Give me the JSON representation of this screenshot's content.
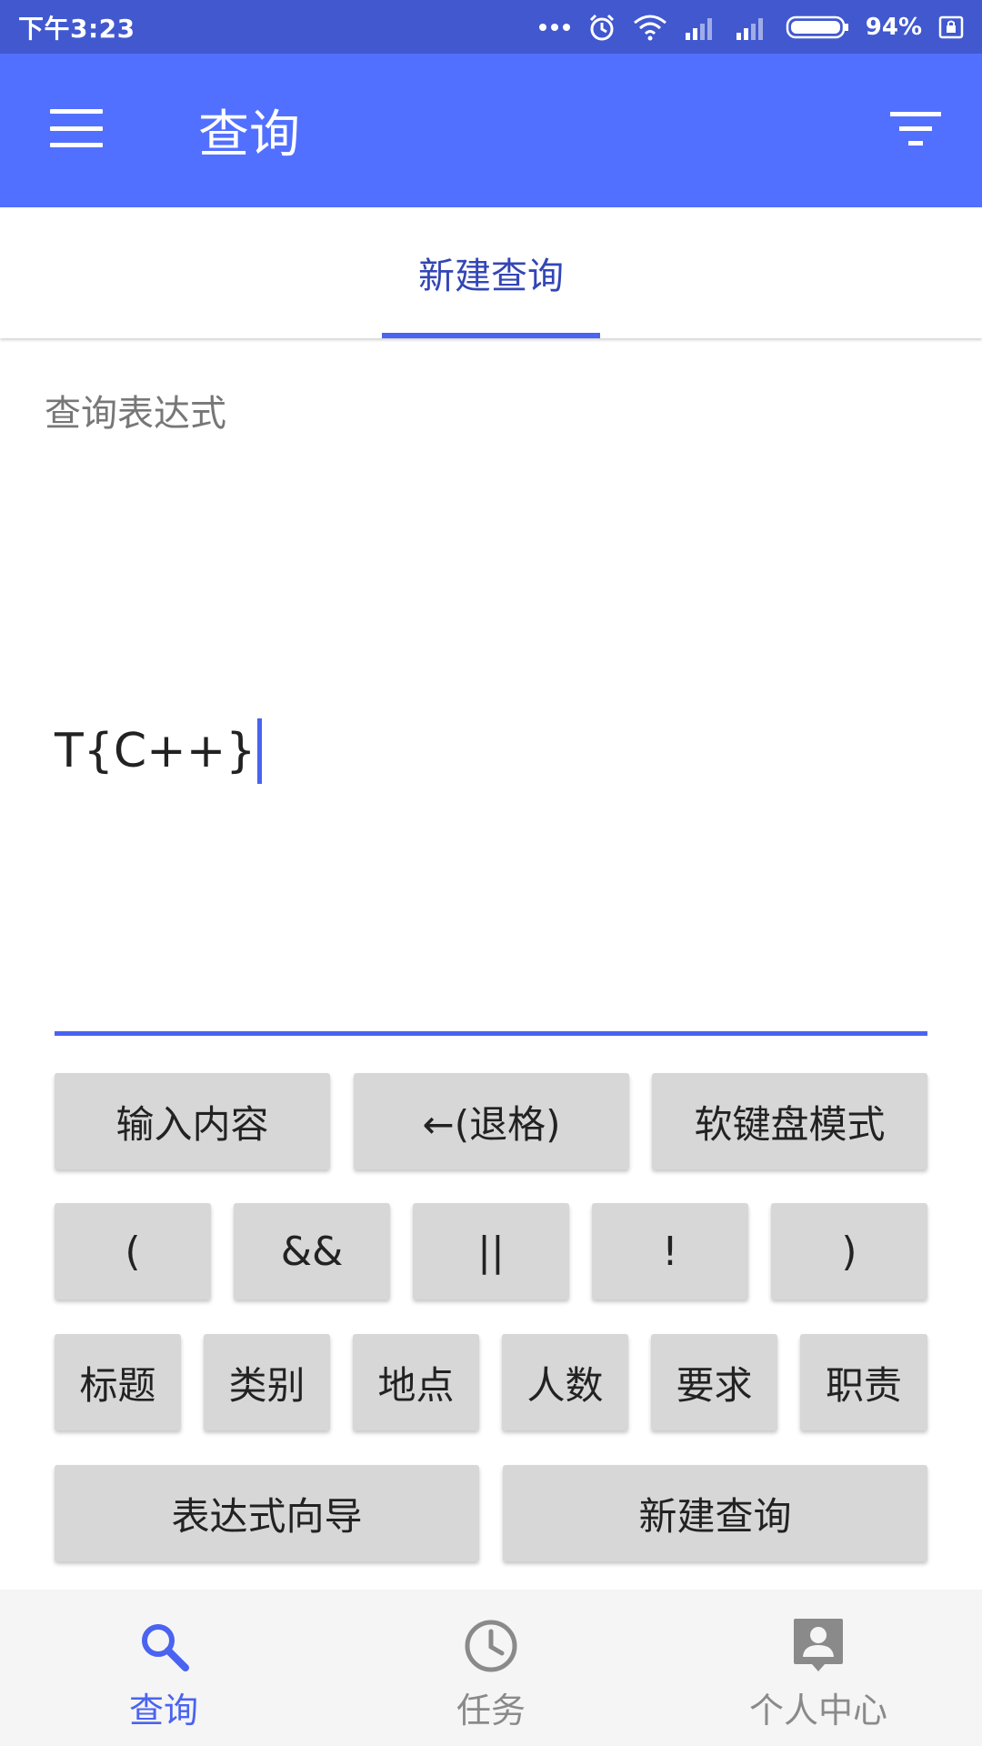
{
  "status_bar": {
    "time": "下午3:23",
    "battery": "94%"
  },
  "app_bar": {
    "title": "查询",
    "menu_icon": "menu-icon",
    "filter_icon": "filter-icon"
  },
  "tabs": [
    {
      "label": "新建查询",
      "active": true
    }
  ],
  "query": {
    "label": "查询表达式",
    "expression": "T{C++}"
  },
  "keypad": {
    "row1": [
      "输入内容",
      "←(退格)",
      "软键盘模式"
    ],
    "row2": [
      "(",
      "&&",
      "||",
      "!",
      ")"
    ],
    "row3": [
      "标题",
      "类别",
      "地点",
      "人数",
      "要求",
      "职责"
    ],
    "row4": [
      "表达式向导",
      "新建查询"
    ]
  },
  "bottom_nav": [
    {
      "label": "查询",
      "icon": "search-icon",
      "active": true
    },
    {
      "label": "任务",
      "icon": "clock-icon",
      "active": false
    },
    {
      "label": "个人中心",
      "icon": "profile-icon",
      "active": false
    }
  ],
  "colors": {
    "status_bar": "#4158cf",
    "app_bar": "#5270ff",
    "accent": "#4a63f0",
    "key_bg": "#d7d7d7"
  }
}
